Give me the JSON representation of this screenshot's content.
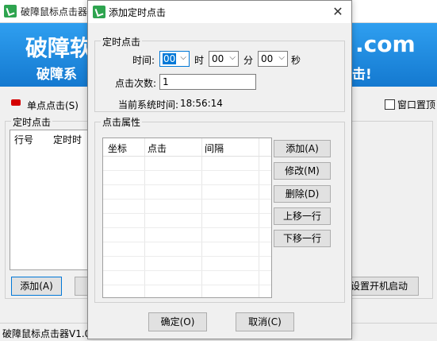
{
  "main_window": {
    "title": "破障鼠标点击器",
    "banner_line1": "破障软",
    "banner_line2": "破障系",
    "banner_right1": ".com",
    "banner_right2": "击!",
    "single_click_label": "单点点击(S)",
    "window_top_label": "窗口置顶",
    "timer_group_label": "定时点击",
    "list_columns": [
      "行号",
      "定时时"
    ],
    "add_button": "添加(A)",
    "boot_button": "设置开机启动",
    "status_text": "破障鼠标点击器V1.0"
  },
  "dialog": {
    "title": "添加定时点击",
    "close_glyph": "✕",
    "timer_group_label": "定时点击",
    "time_label": "时间:",
    "hour_value": "00",
    "hour_unit": "时",
    "minute_value": "00",
    "minute_unit": "分",
    "second_value": "00",
    "second_unit": "秒",
    "click_count_label": "点击次数:",
    "click_count_value": "1",
    "system_time_label": "当前系统时间:",
    "system_time_value": "18:56:14",
    "click_props_label": "点击属性",
    "table_columns": [
      "坐标",
      "点击",
      "间隔"
    ],
    "buttons": {
      "add": "添加(A)",
      "modify": "修改(M)",
      "delete": "删除(D)",
      "move_up": "上移一行",
      "move_down": "下移一行",
      "ok": "确定(O)",
      "cancel": "取消(C)"
    }
  },
  "icons": {
    "app": "app-cursor-icon",
    "dropdown": "chevron-down-icon",
    "close": "close-icon",
    "single_click": "red-indicator-icon"
  },
  "colors": {
    "banner": "#1e8fe0",
    "focus_border": "#0078d7"
  }
}
